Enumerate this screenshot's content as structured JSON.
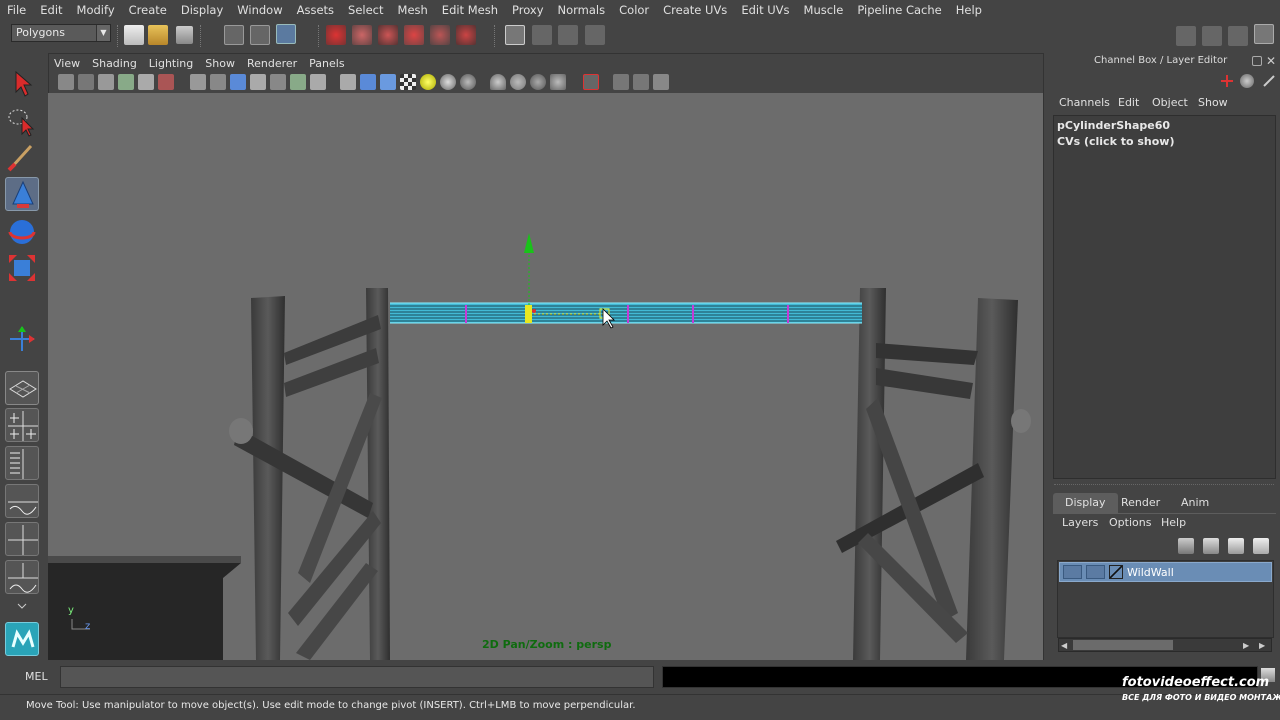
{
  "menubar": {
    "items": [
      "File",
      "Edit",
      "Modify",
      "Create",
      "Display",
      "Window",
      "Assets",
      "Select",
      "Mesh",
      "Edit Mesh",
      "Proxy",
      "Normals",
      "Color",
      "Create UVs",
      "Edit UVs",
      "Muscle",
      "Pipeline Cache",
      "Help"
    ]
  },
  "statusline": {
    "mode": "Polygons"
  },
  "panel": {
    "menu": [
      "View",
      "Shading",
      "Lighting",
      "Show",
      "Renderer",
      "Panels"
    ],
    "hud_label": "2D Pan/Zoom : persp",
    "axis_y": "y",
    "axis_z": "z"
  },
  "channelbox": {
    "title": "Channel Box / Layer Editor",
    "menu": [
      "Channels",
      "Edit",
      "Object",
      "Show"
    ],
    "object_name": "pCylinderShape60",
    "cvs_label": "CVs (click to show)"
  },
  "layer_editor": {
    "tabs": [
      "Display",
      "Render",
      "Anim"
    ],
    "active_tab": "Display",
    "menu": [
      "Layers",
      "Options",
      "Help"
    ],
    "layers": [
      {
        "name": "WildWall"
      }
    ]
  },
  "commandline": {
    "label": "MEL"
  },
  "helpline": {
    "text": "Move Tool: Use manipulator to move object(s). Use edit mode to change pivot (INSERT).  Ctrl+LMB to move perpendicular."
  },
  "watermark": {
    "line1": "fotovideoeffect.com",
    "line2": "ВСЕ ДЛЯ ФОТО И ВИДЕО МОНТАЖА!"
  },
  "colors": {
    "viewport_bg": "#6c6c6c",
    "selection_cyan": "#34d8f0",
    "manipulator_green": "#19c319",
    "layer_highlight": "#6a8db5"
  }
}
